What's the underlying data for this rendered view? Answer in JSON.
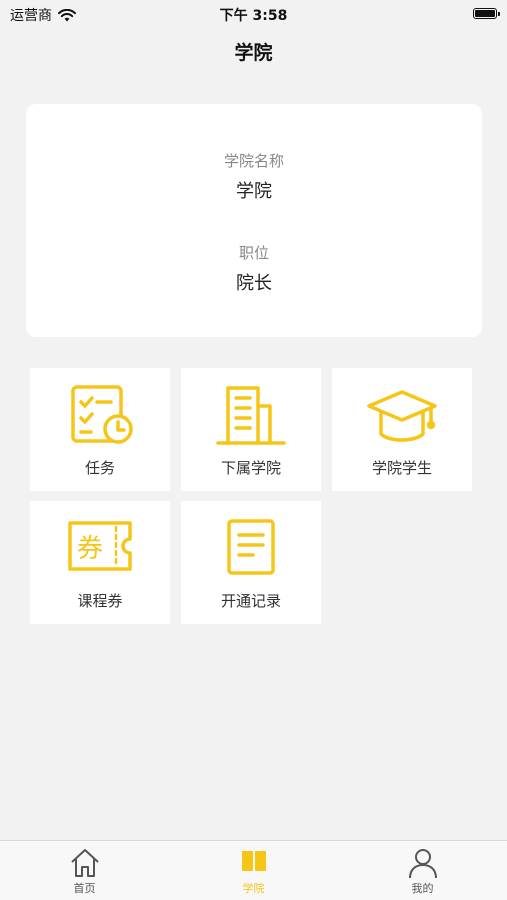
{
  "status_bar": {
    "carrier": "运营商",
    "time": "下午 3:58",
    "icons": [
      "wifi-icon",
      "battery-icon"
    ]
  },
  "nav": {
    "title": "学院"
  },
  "info_card": {
    "name_label": "学院名称",
    "name_value": "学院",
    "position_label": "职位",
    "position_value": "院长"
  },
  "grid": {
    "items": [
      {
        "label": "任务",
        "icon": "task-checklist-clock-icon"
      },
      {
        "label": "下属学院",
        "icon": "building-icon"
      },
      {
        "label": "学院学生",
        "icon": "graduation-cap-icon"
      },
      {
        "label": "课程券",
        "icon": "coupon-ticket-icon"
      },
      {
        "label": "开通记录",
        "icon": "document-record-icon"
      }
    ]
  },
  "tab_bar": {
    "tabs": [
      {
        "label": "首页",
        "icon": "home-icon",
        "active": false
      },
      {
        "label": "学院",
        "icon": "book-icon",
        "active": true
      },
      {
        "label": "我的",
        "icon": "user-icon",
        "active": false
      }
    ]
  },
  "colors": {
    "accent": "#f5c518",
    "background": "#f2f2f2",
    "card": "#ffffff"
  }
}
